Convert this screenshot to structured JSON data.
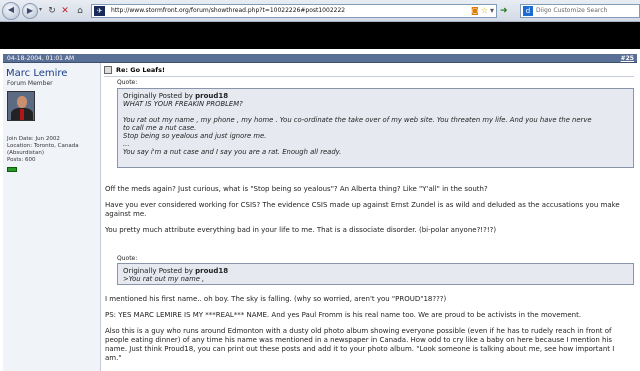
{
  "browser": {
    "url": "http://www.stormfront.org/forum/showthread.php?t=10022226#post1002222",
    "search_placeholder": "Diigo Customize Search"
  },
  "post": {
    "date": "04-18-2004, 01:01 AM",
    "number": "#25",
    "title": "Re: Go Leafs!",
    "user": {
      "name": "Marc Lemire",
      "title": "Forum Member",
      "join_date": "Join Date: Jun 2002",
      "location": "Location: Toronto, Canada (Absurdistan)",
      "posts": "Posts: 600"
    },
    "quote1": {
      "label": "Quote:",
      "header_prefix": "Originally Posted by ",
      "author": "proud18",
      "lines": [
        "WHAT IS YOUR FREAKIN PROBLEM?",
        "",
        "You rat out my name , my phone , my home . You co-ordinate the take over of my web site. You threaten my life. And you have the nerve",
        "to call me a nut case.",
        "Stop being so yealous and just ignore me.",
        "...",
        "You say i'm a nut case and I say you are a rat. Enough all ready."
      ]
    },
    "paragraphs": [
      "Off the meds again? Just curious, what is \"Stop being so yealous\"? An Alberta thing? Like \"Y'all\" in the south?",
      "Have you ever considered working for CSIS? The evidence CSIS made up against Ernst Zundel is as wild and deluded as the accusations you make against me.",
      "You pretty much attribute everything bad in your life to me. That is a dissociate disorder. (bi-polar anyone?!?!?)"
    ],
    "quote2": {
      "label": "Quote:",
      "header_prefix": "Originally Posted by ",
      "author": "proud18",
      "line": ">You rat out my name ,"
    },
    "paragraphs2": [
      "I mentioned his first name.. oh boy. The sky is falling. (why so worried, aren't you \"PROUD\"18???)",
      "PS: YES MARC LEMIRE IS MY ***REAL*** NAME. And yes Paul Fromm is his real name too. We are proud to be activists in the movement.",
      "Also this is a guy who runs around Edmonton with a dusty old photo album showing everyone possible (even if he has to rudely reach in front of people eating dinner) of any time his name was mentioned in a newspaper in Canada. How odd to cry like a baby on here because I mention his name. Just think Proud18, you can print out these posts and add it to your photo album. \"Look someone is talking about me, see how important I am.\""
    ]
  }
}
